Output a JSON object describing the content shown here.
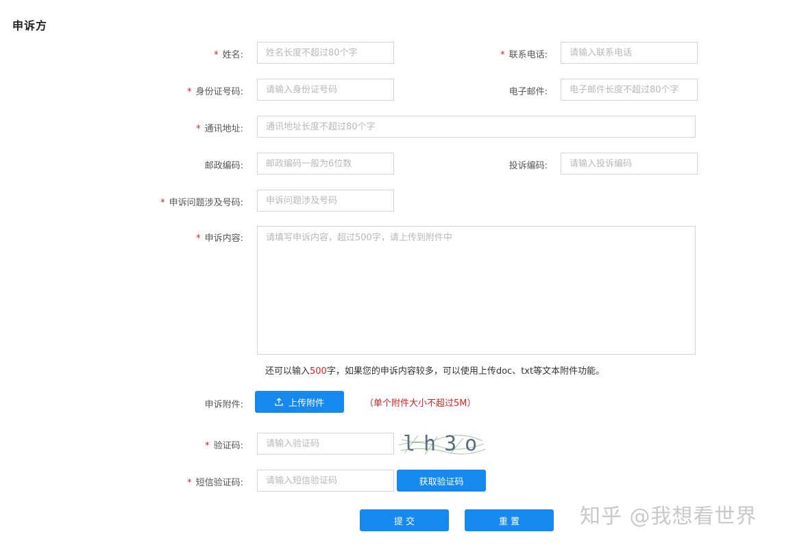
{
  "section_title": "申诉方",
  "required_mark": "*",
  "fields": {
    "name": {
      "label": "姓名:",
      "placeholder": "姓名长度不超过80个字"
    },
    "phone": {
      "label": "联系电话:",
      "placeholder": "请输入联系电话"
    },
    "id_number": {
      "label": "身份证号码:",
      "placeholder": "请输入身份证号码"
    },
    "email": {
      "label": "电子邮件:",
      "placeholder": "电子邮件长度不超过80个字"
    },
    "address": {
      "label": "通讯地址:",
      "placeholder": "通讯地址长度不超过80个字"
    },
    "postcode": {
      "label": "邮政编码:",
      "placeholder": "邮政编码一般为6位数"
    },
    "complaint_code": {
      "label": "投诉编码:",
      "placeholder": "请输入投诉编码"
    },
    "involved_number": {
      "label": "申诉问题涉及号码:",
      "placeholder": "申诉问题涉及号码"
    },
    "content": {
      "label": "申诉内容:",
      "placeholder": "请填写申诉内容，超过500字，请上传到附件中"
    },
    "captcha": {
      "label": "验证码:",
      "placeholder": "请输入验证码",
      "image_text": "lh3o"
    },
    "sms_code": {
      "label": "短信验证码:",
      "placeholder": "请输入短信验证码"
    }
  },
  "content_hint": {
    "prefix": "还可以输入",
    "count": "500",
    "suffix": "字，如果您的申诉内容较多，可以使用上传doc、txt等文本附件功能。"
  },
  "attachment": {
    "label": "申诉附件:",
    "button_label": "上传附件",
    "button_icon": "upload-icon",
    "note": "（单个附件大小不超过5M）"
  },
  "buttons": {
    "get_code": "获取验证码",
    "submit": "提 交",
    "reset": "重 置"
  },
  "watermark": "知乎 @我想看世界",
  "colors": {
    "primary": "#1589ee",
    "required": "#e02020",
    "border": "#d4d4d4"
  }
}
